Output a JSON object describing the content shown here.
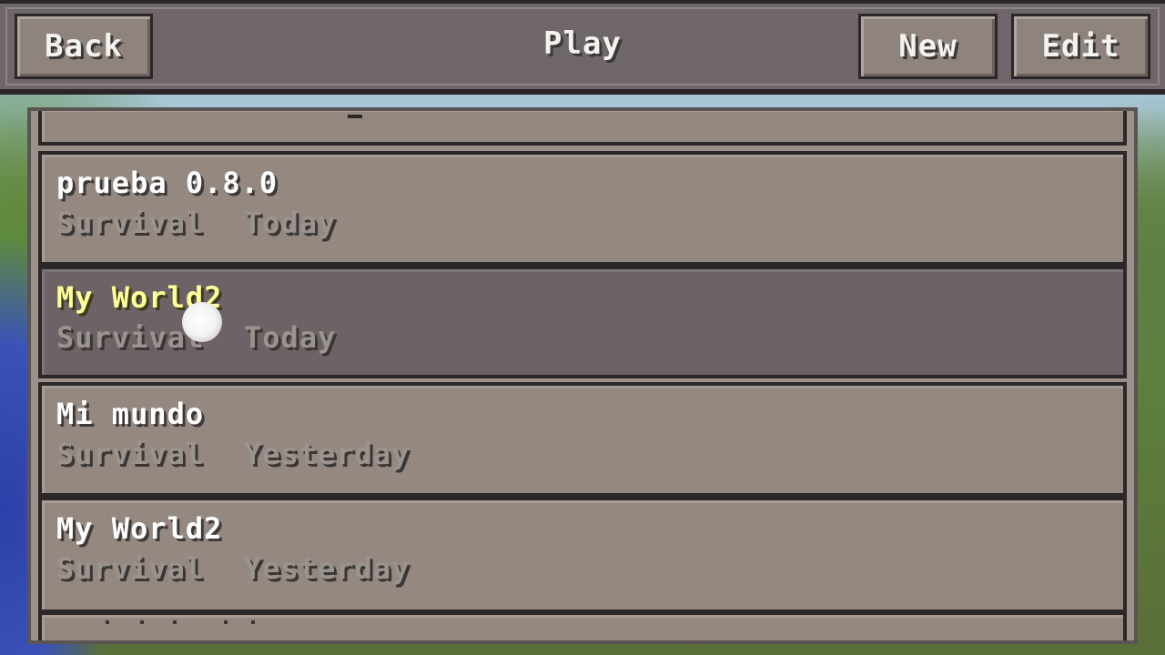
{
  "header": {
    "title": "Play",
    "back_label": "Back",
    "new_label": "New",
    "edit_label": "Edit"
  },
  "worlds": [
    {
      "name": "prueba 0.8.0",
      "mode": "Survival",
      "date": "Today",
      "selected": false
    },
    {
      "name": "My World2",
      "mode": "Survival",
      "date": "Today",
      "selected": true
    },
    {
      "name": "Mi mundo",
      "mode": "Survival",
      "date": "Yesterday",
      "selected": false
    },
    {
      "name": "My World2",
      "mode": "Survival",
      "date": "Yesterday",
      "selected": false
    }
  ],
  "colors": {
    "selected_name": "#ffff9a",
    "row_bg": "#958880",
    "selected_row_bg": "#6d6366",
    "topbar_bg": "#6e6669"
  }
}
